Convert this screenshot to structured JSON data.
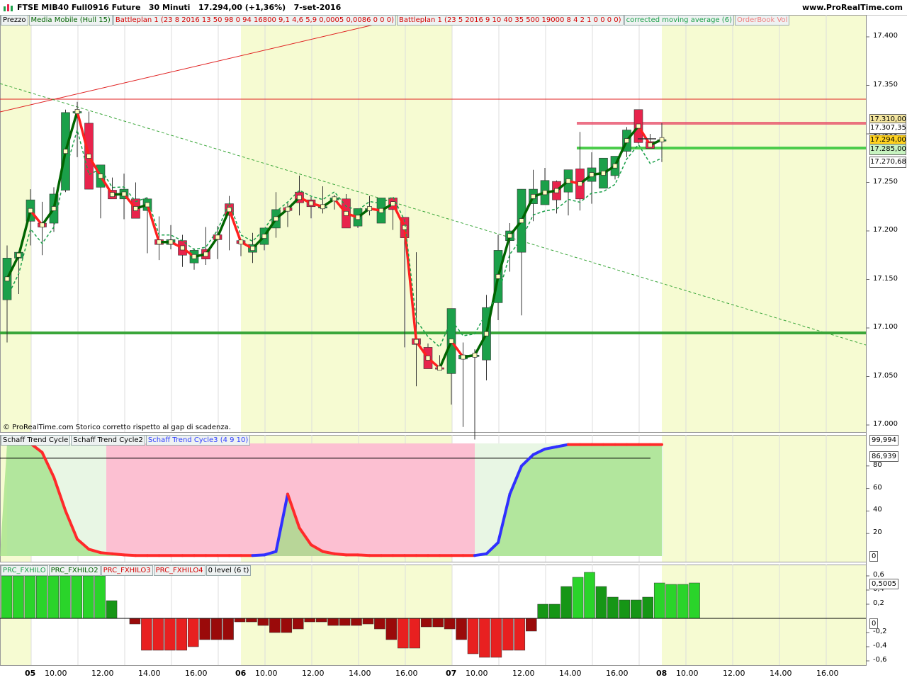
{
  "title": {
    "instrument": "FTSE MIB40 Full0916 Future",
    "interval": "30 Minuti",
    "last": "17.294,00 (+1,36%)",
    "date": "7-set-2016",
    "brand": "www.ProRealTime.com"
  },
  "price_legend": [
    "Prezzo",
    "Media Mobile (Hull 15)",
    "Battleplan 1 (23 8 2016 13 50 98 0 94 16800 9,1 4,6 5,9 0,0005 0,0086 0 0 0)",
    "Battleplan 1 (23 5 2016 9 10 40 35 500 19000 8 4 2 1 0 0 0 0)",
    "corrected moving average (6)",
    "OrderBook Vol"
  ],
  "schaff_legend": [
    "Schaff Trend Cycle",
    "Schaff Trend Cycle2",
    "Schaff Trend Cycle3 (4 9 10)"
  ],
  "fxhilo_legend": [
    "PRC_FXHILO",
    "PRC_FXHILO2",
    "PRC_FXHILO3",
    "PRC_FXHILO4",
    "0 level (6 t)"
  ],
  "price_ticks": [
    "17.400",
    "17.350",
    "17.300",
    "17.250",
    "17.200",
    "17.150",
    "17.100",
    "17.050",
    "17.000"
  ],
  "price_boxes": [
    {
      "label": "17.310,00",
      "bg": "#f4e6a0"
    },
    {
      "label": "17.307,35",
      "bg": "#ffffff"
    },
    {
      "label": "17.294,00",
      "bg": "#ffd21f"
    },
    {
      "label": "17.285,00",
      "bg": "#c7f3c0"
    },
    {
      "label": "17.270,68",
      "bg": "#ffffff"
    }
  ],
  "schaff_ticks": [
    "80",
    "60",
    "40",
    "20"
  ],
  "schaff_boxes": [
    "99,994",
    "86,939",
    "0"
  ],
  "fx_ticks": [
    "0,6",
    "0,4",
    "0,2",
    "-0,2",
    "-0,4",
    "-0,6"
  ],
  "fx_boxes": [
    "0,5005",
    "0"
  ],
  "x_labels": [
    {
      "t": "05",
      "day": true
    },
    {
      "t": "10.00"
    },
    {
      "t": "12.00"
    },
    {
      "t": "14.00"
    },
    {
      "t": "16.00"
    },
    {
      "t": "06",
      "day": true
    },
    {
      "t": "10.00"
    },
    {
      "t": "12.00"
    },
    {
      "t": "14.00"
    },
    {
      "t": "16.00"
    },
    {
      "t": "07",
      "day": true
    },
    {
      "t": "10.00"
    },
    {
      "t": "12.00"
    },
    {
      "t": "14.00"
    },
    {
      "t": "16.00"
    },
    {
      "t": "08",
      "day": true
    },
    {
      "t": "10.00"
    },
    {
      "t": "12.00"
    },
    {
      "t": "14.00"
    },
    {
      "t": "16.00"
    }
  ],
  "copyright": "© ProRealTime.com  Storico corretto rispetto al gap di scadenza.",
  "colors": {
    "bull": "#1ba04a",
    "bear": "#e8234c",
    "session": "#f6fbd2",
    "hull_up": "#006400",
    "hull_down": "#ff2020"
  },
  "chart_data": {
    "type": "candlestick",
    "candles": [
      [
        17129,
        17185,
        17085,
        17172
      ],
      [
        17172,
        17150,
        17135,
        17178
      ],
      [
        17210,
        17243,
        17185,
        17232
      ],
      [
        17208,
        17230,
        17175,
        17204
      ],
      [
        17208,
        17245,
        17199,
        17238
      ],
      [
        17242,
        17325,
        17240,
        17322
      ],
      [
        17323,
        17333,
        17276,
        17323
      ],
      [
        17311,
        17323,
        17263,
        17243
      ],
      [
        17245,
        17265,
        17213,
        17268
      ],
      [
        17242,
        17255,
        17238,
        17233
      ],
      [
        17233,
        17259,
        17212,
        17243
      ],
      [
        17233,
        17250,
        17215,
        17213
      ],
      [
        17221,
        17234,
        17177,
        17233
      ],
      [
        17191,
        17215,
        17170,
        17186
      ],
      [
        17186,
        17206,
        17181,
        17191
      ],
      [
        17190,
        17196,
        17163,
        17175
      ],
      [
        17167,
        17182,
        17160,
        17180
      ],
      [
        17181,
        17204,
        17165,
        17171
      ],
      [
        17196,
        17205,
        17171,
        17191
      ],
      [
        17228,
        17236,
        17180,
        17216
      ],
      [
        17190,
        17185,
        17174,
        17187
      ],
      [
        17178,
        17198,
        17167,
        17186
      ],
      [
        17186,
        17201,
        17180,
        17203
      ],
      [
        17203,
        17240,
        17193,
        17222
      ],
      [
        17224,
        17229,
        17204,
        17221
      ],
      [
        17240,
        17257,
        17216,
        17229
      ],
      [
        17232,
        17235,
        17213,
        17225
      ],
      [
        17225,
        17246,
        17218,
        17225
      ],
      [
        17232,
        17237,
        17222,
        17234
      ],
      [
        17233,
        17238,
        17212,
        17203
      ],
      [
        17205,
        17214,
        17203,
        17223
      ],
      [
        17223,
        17236,
        17216,
        17223
      ],
      [
        17208,
        17232,
        17216,
        17234
      ],
      [
        17234,
        17230,
        17201,
        17222
      ],
      [
        17214,
        17212,
        17080,
        17193
      ],
      [
        17089,
        17178,
        17040,
        17083
      ],
      [
        17080,
        17084,
        17061,
        17058
      ],
      [
        17059,
        17072,
        17058,
        17058
      ],
      [
        17053,
        17110,
        17021,
        17120
      ],
      [
        17068,
        17085,
        16998,
        17072
      ],
      [
        17072,
        17078,
        16985,
        17072
      ],
      [
        17067,
        17134,
        17046,
        17121
      ],
      [
        17126,
        17196,
        17108,
        17180
      ],
      [
        17190,
        17208,
        17158,
        17200
      ],
      [
        17178,
        17236,
        17113,
        17243
      ],
      [
        17228,
        17263,
        17210,
        17243
      ],
      [
        17227,
        17265,
        17235,
        17252
      ],
      [
        17251,
        17252,
        17218,
        17232
      ],
      [
        17240,
        17260,
        17216,
        17263
      ],
      [
        17264,
        17302,
        17221,
        17233
      ],
      [
        17251,
        17281,
        17228,
        17265
      ],
      [
        17244,
        17265,
        17244,
        17275
      ],
      [
        17257,
        17277,
        17253,
        17277
      ],
      [
        17282,
        17307,
        17276,
        17304
      ],
      [
        17325,
        17325,
        17290,
        17291
      ],
      [
        17292,
        17300,
        17285,
        17285
      ],
      [
        17294,
        17311,
        17271,
        17294
      ]
    ],
    "y_range": [
      17000,
      17400
    ]
  }
}
